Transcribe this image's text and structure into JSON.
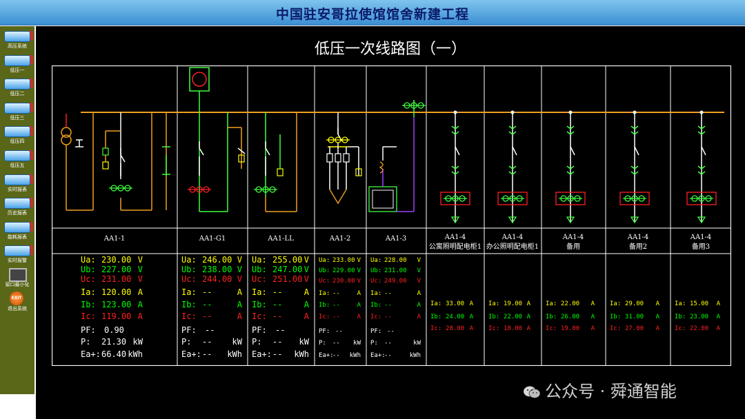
{
  "header": {
    "title": "中国驻安哥拉使馆馆舍新建工程"
  },
  "sidebar": {
    "items": [
      {
        "label": "高压系统",
        "icon": "nav-button-icon"
      },
      {
        "label": "低压一",
        "icon": "nav-button-icon"
      },
      {
        "label": "低压二",
        "icon": "nav-button-icon"
      },
      {
        "label": "低压三",
        "icon": "nav-button-icon"
      },
      {
        "label": "低压四",
        "icon": "nav-button-icon"
      },
      {
        "label": "低压五",
        "icon": "nav-button-icon"
      },
      {
        "label": "实时报表",
        "icon": "nav-button-icon"
      },
      {
        "label": "历史报表",
        "icon": "nav-button-icon"
      },
      {
        "label": "能耗报表",
        "icon": "nav-button-icon"
      },
      {
        "label": "实时报警",
        "icon": "nav-button-icon"
      },
      {
        "label": "窗口最小化",
        "icon": "monitor-icon"
      },
      {
        "label": "退出系统",
        "icon": "exit-icon",
        "badge": "EXIT"
      }
    ]
  },
  "page": {
    "title": "低压一次线路图（一）"
  },
  "colors": {
    "ua": "#ffff00",
    "ub": "#00ff00",
    "uc": "#ff2020",
    "busbar": "#f0a020",
    "white": "#ffffff"
  },
  "panels": [
    {
      "id": "AA1-1",
      "name": "AA1-1",
      "sub": "",
      "ua": "Ua:",
      "ua_val": "230.00",
      "ua_unit": "V",
      "ub": "Ub:",
      "ub_val": "227.00",
      "ub_unit": "V",
      "uc": "Uc:",
      "uc_val": "231.00",
      "uc_unit": "V",
      "ia": "Ia:",
      "ia_val": "120.00",
      "ia_unit": "A",
      "ib": "Ib:",
      "ib_val": "123.00",
      "ib_unit": "A",
      "ic": "Ic:",
      "ic_val": "119.00",
      "ic_unit": "A",
      "pf": "PF:",
      "pf_val": "0.90",
      "p": "P:",
      "p_val": "21.30",
      "p_unit": "kW",
      "ea": "Ea+:",
      "ea_val": "66.40",
      "ea_unit": "kWh"
    },
    {
      "id": "AA1-G1",
      "name": "AA1-G1",
      "sub": "",
      "ua": "Ua:",
      "ua_val": "246.00",
      "ua_unit": "V",
      "ub": "Ub:",
      "ub_val": "238.00",
      "ub_unit": "V",
      "uc": "Uc:",
      "uc_val": "244.00",
      "uc_unit": "V",
      "ia": "Ia:",
      "ia_val": "--",
      "ia_unit": "A",
      "ib": "Ib:",
      "ib_val": "--",
      "ib_unit": "A",
      "ic": "Ic:",
      "ic_val": "--",
      "ic_unit": "A",
      "pf": "PF:",
      "pf_val": "--",
      "p": "P:",
      "p_val": "--",
      "p_unit": "kW",
      "ea": "Ea+:",
      "ea_val": "--",
      "ea_unit": "kWh"
    },
    {
      "id": "AA1-LL",
      "name": "AA1-LL",
      "sub": "",
      "ua": "Ua:",
      "ua_val": "255.00",
      "ua_unit": "V",
      "ub": "Ub:",
      "ub_val": "247.00",
      "ub_unit": "V",
      "uc": "Uc:",
      "uc_val": "251.00",
      "uc_unit": "V",
      "ia": "Ia:",
      "ia_val": "--",
      "ia_unit": "A",
      "ib": "Ib:",
      "ib_val": "--",
      "ib_unit": "A",
      "ic": "Ic:",
      "ic_val": "--",
      "ic_unit": "A",
      "pf": "PF:",
      "pf_val": "--",
      "p": "P:",
      "p_val": "--",
      "p_unit": "kW",
      "ea": "Ea+:",
      "ea_val": "--",
      "ea_unit": "kWh"
    },
    {
      "id": "AA1-2",
      "name": "AA1-2",
      "sub": "",
      "ua": "Ua:",
      "ua_val": "233.00",
      "ua_unit": "V",
      "ub": "Ub:",
      "ub_val": "229.00",
      "ub_unit": "V",
      "uc": "Uc:",
      "uc_val": "230.00",
      "uc_unit": "V",
      "ia": "Ia:",
      "ia_val": "--",
      "ia_unit": "A",
      "ib": "Ib:",
      "ib_val": "--",
      "ib_unit": "A",
      "ic": "Ic:",
      "ic_val": "--",
      "ic_unit": "A",
      "pf": "PF:",
      "pf_val": "--",
      "p": "P:",
      "p_val": "--",
      "p_unit": "kW",
      "ea": "Ea+:",
      "ea_val": "--",
      "ea_unit": "kWh"
    },
    {
      "id": "AA1-3",
      "name": "AA1-3",
      "sub": "",
      "ua": "Ua:",
      "ua_val": "228.00",
      "ua_unit": "V",
      "ub": "Ub:",
      "ub_val": "231.00",
      "ub_unit": "V",
      "uc": "Uc:",
      "uc_val": "249.00",
      "uc_unit": "V",
      "ia": "Ia:",
      "ia_val": "--",
      "ia_unit": "A",
      "ib": "Ib:",
      "ib_val": "--",
      "ib_unit": "A",
      "ic": "Ic:",
      "ic_val": "--",
      "ic_unit": "A",
      "pf": "PF:",
      "pf_val": "--",
      "p": "P:",
      "p_val": "--",
      "p_unit": "kW",
      "ea": "Ea+:",
      "ea_val": "--",
      "ea_unit": "kWh"
    },
    {
      "id": "AA1-4a",
      "name": "AA1-4",
      "sub": "公寓照明配电柜1",
      "ia": "Ia:",
      "ia_val": "33.00",
      "ia_unit": "A",
      "ib": "Ib:",
      "ib_val": "24.00",
      "ib_unit": "A",
      "ic": "Ic:",
      "ic_val": "28.00",
      "ic_unit": "A"
    },
    {
      "id": "AA1-4b",
      "name": "AA1-4",
      "sub": "办公照明配电柜1",
      "ia": "Ia:",
      "ia_val": "19.00",
      "ia_unit": "A",
      "ib": "Ib:",
      "ib_val": "22.00",
      "ib_unit": "A",
      "ic": "Ic:",
      "ic_val": "18.00",
      "ic_unit": "A"
    },
    {
      "id": "AA1-4c",
      "name": "AA1-4",
      "sub": "备用",
      "ia": "Ia:",
      "ia_val": "22.00",
      "ia_unit": "A",
      "ib": "Ib:",
      "ib_val": "26.00",
      "ib_unit": "A",
      "ic": "Ic:",
      "ic_val": "19.00",
      "ic_unit": "A"
    },
    {
      "id": "AA1-4d",
      "name": "AA1-4",
      "sub": "备用2",
      "ia": "Ia:",
      "ia_val": "29.00",
      "ia_unit": "A",
      "ib": "Ib:",
      "ib_val": "31.00",
      "ib_unit": "A",
      "ic": "Ic:",
      "ic_val": "27.00",
      "ic_unit": "A"
    },
    {
      "id": "AA1-4e",
      "name": "AA1-4",
      "sub": "备用3",
      "ia": "Ia:",
      "ia_val": "15.00",
      "ia_unit": "A",
      "ib": "Ib:",
      "ib_val": "23.00",
      "ib_unit": "A",
      "ic": "Ic:",
      "ic_val": "22.00",
      "ic_unit": "A"
    }
  ],
  "watermark": {
    "text": "公众号 · 舜通智能",
    "icon": "wechat-icon"
  }
}
